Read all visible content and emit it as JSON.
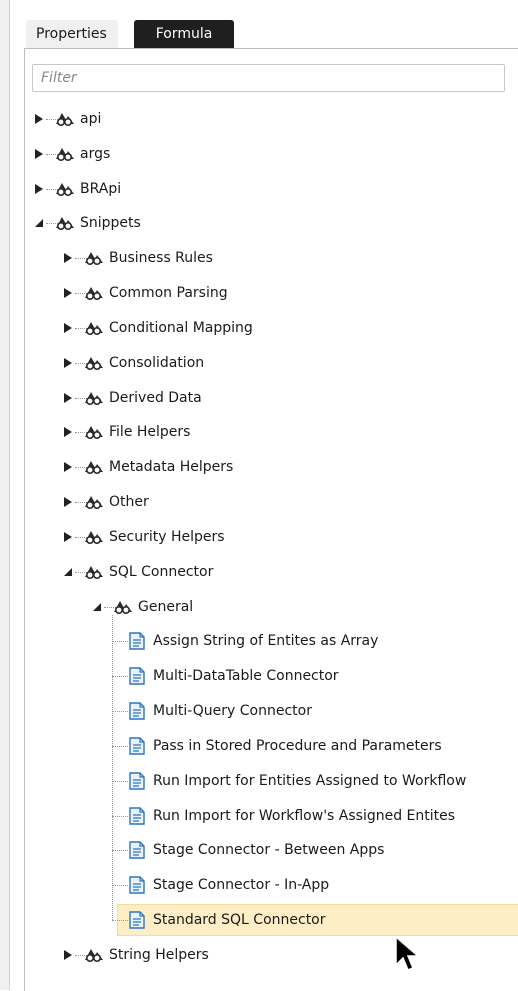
{
  "tabs": [
    {
      "label": "Properties",
      "active": false
    },
    {
      "label": "Formula",
      "active": true
    }
  ],
  "filter": {
    "placeholder": "Filter",
    "value": ""
  },
  "tree": [
    {
      "label": "api",
      "type": "namespace",
      "state": "collapsed",
      "depth": 0
    },
    {
      "label": "args",
      "type": "namespace",
      "state": "collapsed",
      "depth": 0
    },
    {
      "label": "BRApi",
      "type": "namespace",
      "state": "collapsed",
      "depth": 0
    },
    {
      "label": "Snippets",
      "type": "namespace",
      "state": "expanded",
      "depth": 0
    },
    {
      "label": "Business Rules",
      "type": "namespace",
      "state": "collapsed",
      "depth": 1
    },
    {
      "label": "Common Parsing",
      "type": "namespace",
      "state": "collapsed",
      "depth": 1
    },
    {
      "label": "Conditional Mapping",
      "type": "namespace",
      "state": "collapsed",
      "depth": 1
    },
    {
      "label": "Consolidation",
      "type": "namespace",
      "state": "collapsed",
      "depth": 1
    },
    {
      "label": "Derived Data",
      "type": "namespace",
      "state": "collapsed",
      "depth": 1
    },
    {
      "label": "File Helpers",
      "type": "namespace",
      "state": "collapsed",
      "depth": 1
    },
    {
      "label": "Metadata Helpers",
      "type": "namespace",
      "state": "collapsed",
      "depth": 1
    },
    {
      "label": "Other",
      "type": "namespace",
      "state": "collapsed",
      "depth": 1
    },
    {
      "label": "Security Helpers",
      "type": "namespace",
      "state": "collapsed",
      "depth": 1
    },
    {
      "label": "SQL Connector",
      "type": "namespace",
      "state": "expanded",
      "depth": 1
    },
    {
      "label": "General",
      "type": "namespace",
      "state": "expanded",
      "depth": 2
    },
    {
      "label": "Assign String of Entites as Array",
      "type": "snippet",
      "depth": 3
    },
    {
      "label": "Multi-DataTable Connector",
      "type": "snippet",
      "depth": 3
    },
    {
      "label": "Multi-Query Connector",
      "type": "snippet",
      "depth": 3
    },
    {
      "label": "Pass in Stored Procedure and Parameters",
      "type": "snippet",
      "depth": 3
    },
    {
      "label": "Run Import for Entities Assigned to Workflow",
      "type": "snippet",
      "depth": 3
    },
    {
      "label": "Run Import for Workflow's Assigned Entites",
      "type": "snippet",
      "depth": 3
    },
    {
      "label": "Stage Connector - Between Apps",
      "type": "snippet",
      "depth": 3
    },
    {
      "label": "Stage Connector - In-App",
      "type": "snippet",
      "depth": 3
    },
    {
      "label": "Standard SQL Connector",
      "type": "snippet",
      "depth": 3,
      "selected": true
    },
    {
      "label": "String Helpers",
      "type": "namespace",
      "state": "collapsed",
      "depth": 1
    }
  ],
  "colors": {
    "selected_bg": "#fdeec6",
    "active_tab_bg": "#1f1f1f",
    "doc_icon_blue": "#2e74c0"
  },
  "icons": {
    "namespace": "namespace-icon",
    "snippet": "document-icon",
    "collapsed": "triangle-right-icon",
    "expanded": "triangle-down-icon",
    "cursor": "mouse-pointer-icon"
  }
}
